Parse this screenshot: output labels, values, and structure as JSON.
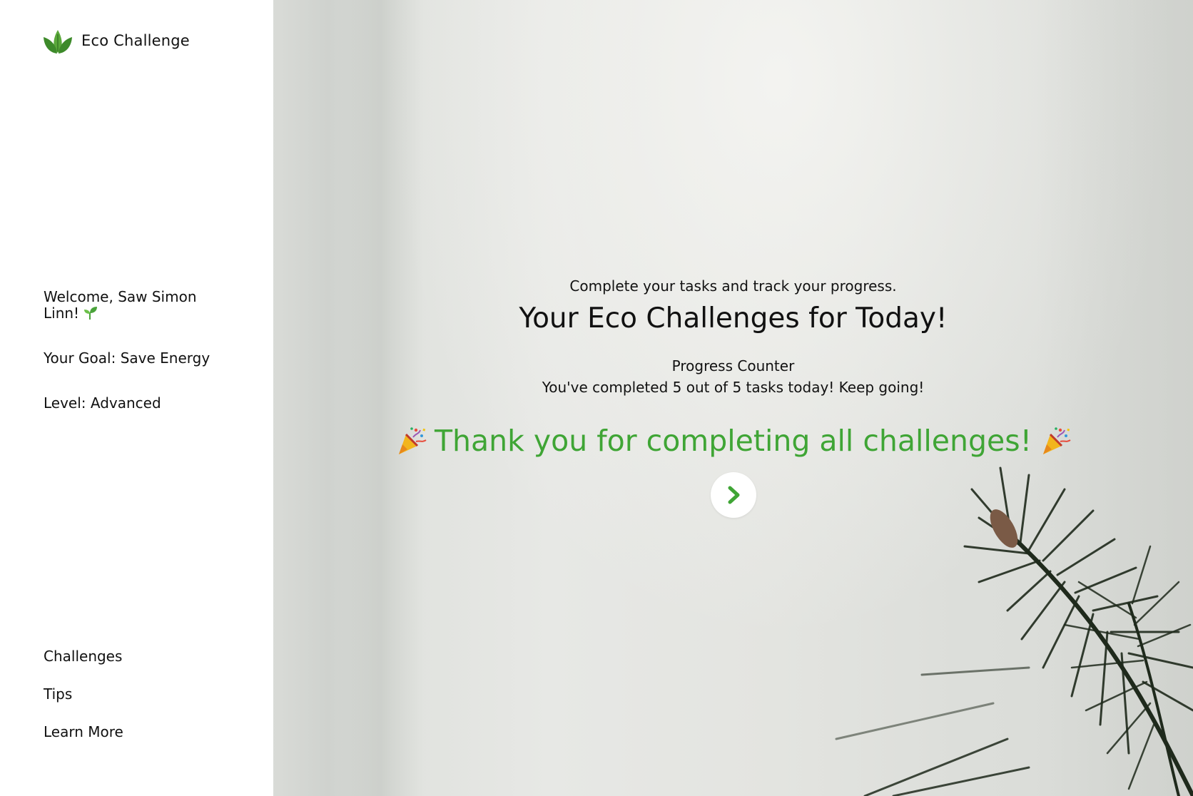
{
  "brand": {
    "name": "Eco Challenge",
    "logo_icon": "leaves-icon",
    "accent_color": "#3fa535"
  },
  "user": {
    "welcome": "Welcome, Saw Simon Linn!",
    "goal": "Your Goal: Save Energy",
    "level": "Level: Advanced"
  },
  "nav": {
    "items": [
      {
        "label": "Challenges"
      },
      {
        "label": "Tips"
      },
      {
        "label": "Learn More"
      }
    ]
  },
  "main": {
    "subtitle": "Complete your tasks and track your progress.",
    "title": "Your Eco Challenges for Today!",
    "progress_label": "Progress Counter",
    "progress_text": "You've completed 5 out of 5 tasks today! Keep going!",
    "completion_message": "Thank you for completing all challenges!",
    "next_button_icon": "chevron-right-icon"
  }
}
